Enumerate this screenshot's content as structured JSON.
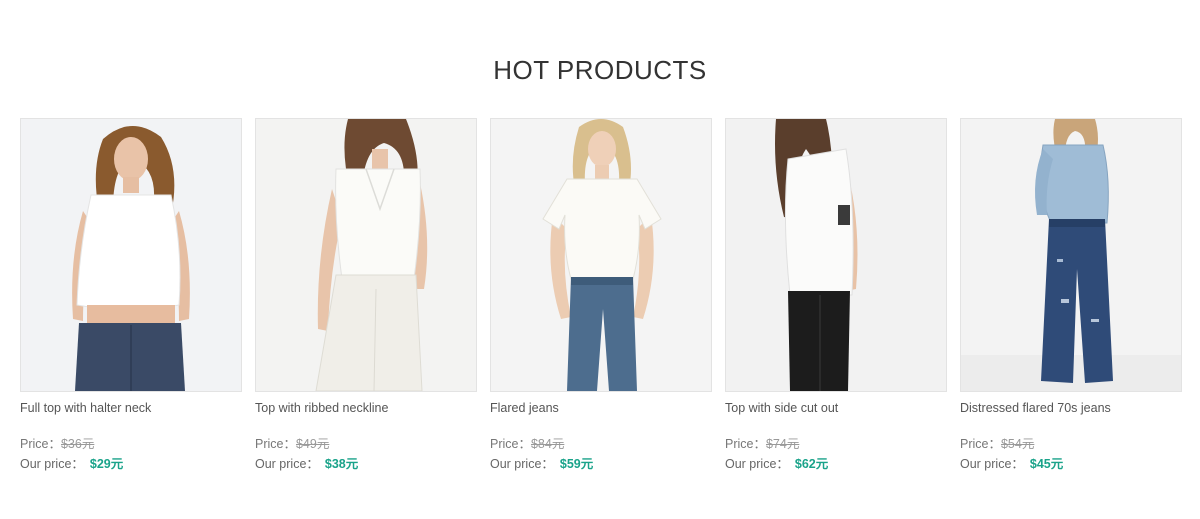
{
  "section": {
    "title": "HOT PRODUCTS"
  },
  "colors": {
    "accent": "#1aa38a",
    "strike": "#999999"
  },
  "products": [
    {
      "name": "Full top with halter neck",
      "price_label": "Price：",
      "old_price": "$36元",
      "our_price_label": "Our price：",
      "new_price": "$29元",
      "image": "model-white-halter-crop-top"
    },
    {
      "name": "Top with ribbed neckline",
      "price_label": "Price：",
      "old_price": "$49元",
      "our_price_label": "Our price：",
      "new_price": "$38元",
      "image": "model-white-v-neck-top"
    },
    {
      "name": "Flared jeans",
      "price_label": "Price：",
      "old_price": "$84元",
      "our_price_label": "Our price：",
      "new_price": "$59元",
      "image": "model-flared-jeans"
    },
    {
      "name": "Top with side cut out",
      "price_label": "Price：",
      "old_price": "$74元",
      "our_price_label": "Our price：",
      "new_price": "$62元",
      "image": "model-side-cut-out-top"
    },
    {
      "name": "Distressed flared 70s jeans",
      "price_label": "Price：",
      "old_price": "$54元",
      "our_price_label": "Our price：",
      "new_price": "$45元",
      "image": "model-distressed-flared-jeans"
    }
  ]
}
